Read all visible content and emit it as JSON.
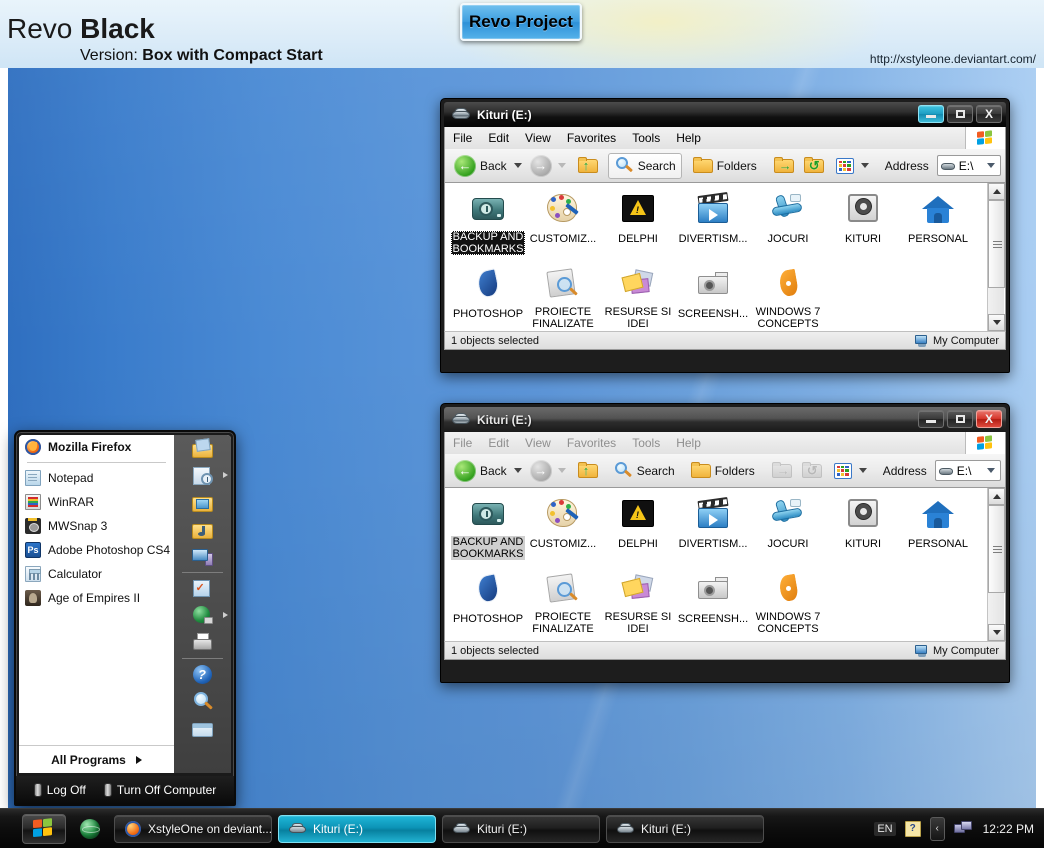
{
  "banner": {
    "title_light": "Revo ",
    "title_bold": "Black",
    "version_label": "Version: ",
    "version_value": "Box with Compact Start",
    "url": "http://xstyleone.deviantart.com/",
    "project_button": "Revo Project",
    "accent_blue": "#3f9fe0"
  },
  "windows": [
    {
      "title": "Kituri (E:)",
      "active": true,
      "menus": [
        "File",
        "Edit",
        "View",
        "Favorites",
        "Tools",
        "Help"
      ],
      "toolbar": {
        "back": "Back",
        "search": "Search",
        "folders": "Folders",
        "address_label": "Address",
        "address_value": "E:\\"
      },
      "status_left": "1 objects selected",
      "status_right": "My Computer",
      "title_buttons": {
        "minimize": "_",
        "maximize": "□",
        "close": "X"
      }
    },
    {
      "title": "Kituri (E:)",
      "active": false,
      "menus": [
        "File",
        "Edit",
        "View",
        "Favorites",
        "Tools",
        "Help"
      ],
      "toolbar": {
        "back": "Back",
        "search": "Search",
        "folders": "Folders",
        "address_label": "Address",
        "address_value": "E:\\"
      },
      "status_left": "1 objects selected",
      "status_right": "My Computer",
      "title_buttons": {
        "minimize": "_",
        "maximize": "□",
        "close": "X"
      }
    }
  ],
  "folder_items": [
    {
      "label": "BACKUP AND BOOKMARKS",
      "icon": "backup-drive-icon",
      "selected": true
    },
    {
      "label": "CUSTOMIZ...",
      "icon": "palette-icon",
      "selected": false
    },
    {
      "label": "DELPHI",
      "icon": "warning-screen-icon",
      "selected": false
    },
    {
      "label": "DIVERTISM...",
      "icon": "movie-clapper-icon",
      "selected": false
    },
    {
      "label": "JOCURI",
      "icon": "joystick-icon",
      "selected": false
    },
    {
      "label": "KITURI",
      "icon": "gear-screen-icon",
      "selected": false
    },
    {
      "label": "PERSONAL",
      "icon": "home-icon",
      "selected": false
    },
    {
      "label": "PHOTOSHOP",
      "icon": "feather-icon",
      "selected": false
    },
    {
      "label": "PROIECTE FINALIZATE",
      "icon": "document-search-icon",
      "selected": false
    },
    {
      "label": "RESURSE SI IDEI",
      "icon": "pictures-icon",
      "selected": false
    },
    {
      "label": "SCREENSH...",
      "icon": "camera-icon",
      "selected": false
    },
    {
      "label": "WINDOWS 7 CONCEPTS ...",
      "icon": "pen-nib-icon",
      "selected": false
    }
  ],
  "start_menu": {
    "pinned": [
      {
        "label": "Mozilla Firefox",
        "icon": "firefox-icon",
        "bold": true
      }
    ],
    "programs": [
      {
        "label": "Notepad",
        "icon": "notepad-icon"
      },
      {
        "label": "WinRAR",
        "icon": "winrar-icon"
      },
      {
        "label": "MWSnap 3",
        "icon": "mwsnap-icon"
      },
      {
        "label": "Adobe Photoshop CS4",
        "icon": "photoshop-icon"
      },
      {
        "label": "Calculator",
        "icon": "calculator-icon"
      },
      {
        "label": "Age of Empires II",
        "icon": "age-of-empires-icon"
      }
    ],
    "all_programs": "All Programs",
    "right_items": [
      {
        "icon": "my-documents-icon",
        "arrow": false
      },
      {
        "icon": "recent-documents-icon",
        "arrow": true
      },
      {
        "icon": "my-pictures-icon",
        "arrow": false
      },
      {
        "icon": "my-music-icon",
        "arrow": false
      },
      {
        "icon": "my-computer-icon",
        "arrow": false
      },
      {
        "icon": "control-panel-icon",
        "arrow": false
      },
      {
        "icon": "network-connections-icon",
        "arrow": true
      },
      {
        "icon": "printers-and-faxes-icon",
        "arrow": false
      },
      {
        "icon": "help-and-support-icon",
        "arrow": false
      },
      {
        "icon": "search-icon",
        "arrow": false
      },
      {
        "icon": "run-icon",
        "arrow": false
      }
    ],
    "log_off": "Log Off",
    "turn_off": "Turn Off Computer"
  },
  "taskbar": {
    "start_icon": "windows-flag-icon",
    "quicklaunch": [
      {
        "icon": "show-desktop-globe-icon"
      }
    ],
    "tasks": [
      {
        "label": "XstyleOne on deviant...",
        "icon": "firefox-icon",
        "active": false
      },
      {
        "label": "Kituri (E:)",
        "icon": "drive-icon",
        "active": true
      },
      {
        "label": "Kituri (E:)",
        "icon": "drive-icon",
        "active": false
      },
      {
        "label": "Kituri (E:)",
        "icon": "drive-icon",
        "active": false
      }
    ],
    "tray": {
      "language": "EN",
      "help_icon": "help-tray-icon",
      "chevron": "‹",
      "network_icon": "network-tray-icon",
      "clock": "12:22 PM"
    }
  }
}
